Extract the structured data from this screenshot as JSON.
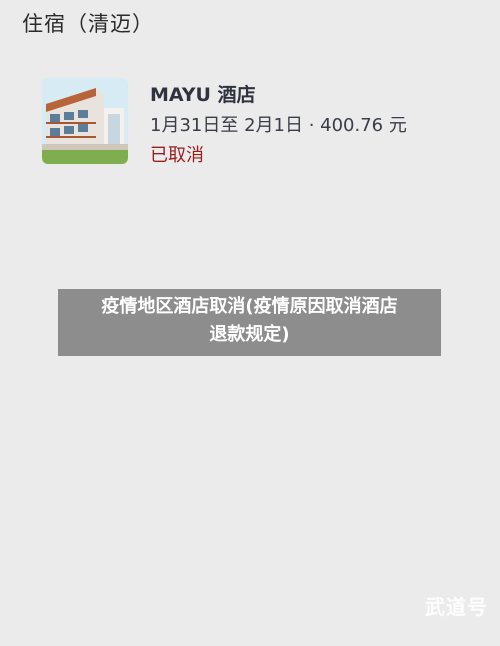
{
  "header": {
    "title": "住宿（清迈）"
  },
  "booking": {
    "hotel_name": "MAYU 酒店",
    "dates_price": "1月31日至 2月1日 · 400.76 元",
    "status": "已取消",
    "status_color": "#9a1e1e",
    "thumbnail_icon": "hotel-building-image"
  },
  "banner": {
    "line1": "疫情地区酒店取消(疫情原因取消酒店",
    "line2": "退款规定)"
  },
  "watermark": {
    "text": "武道号"
  }
}
